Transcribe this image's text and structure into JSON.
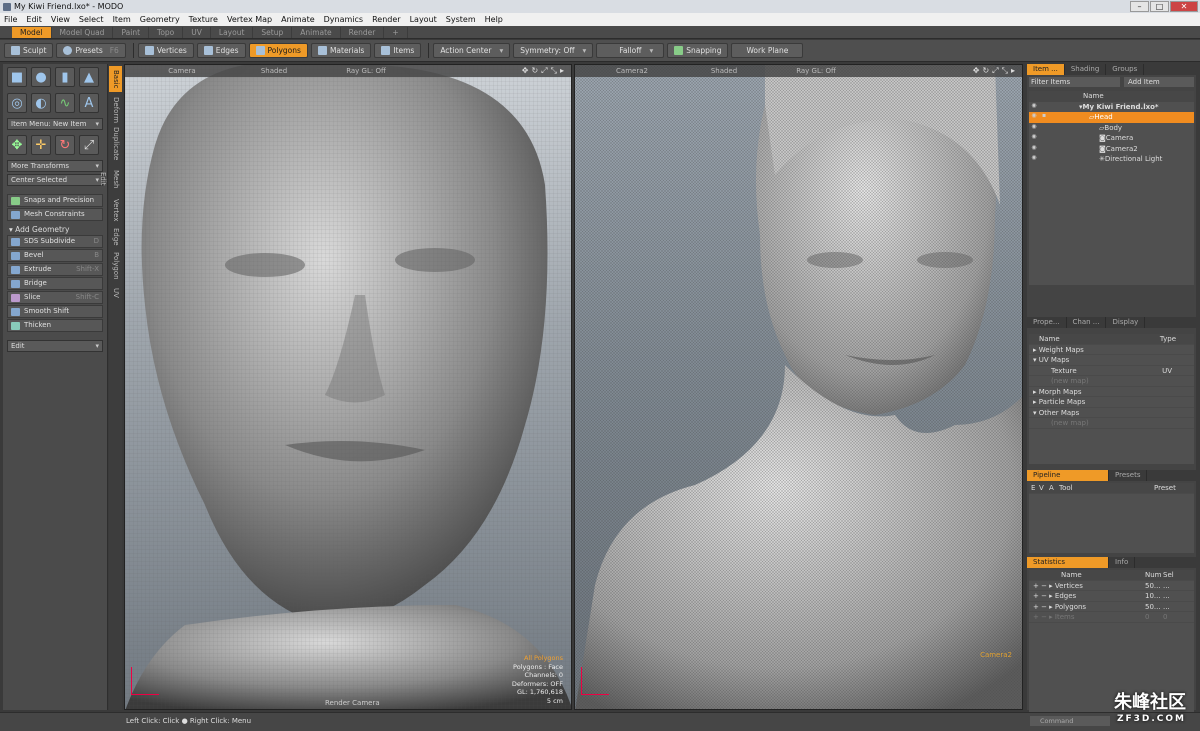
{
  "window": {
    "title": "My Kiwi Friend.lxo* - MODO",
    "min": "–",
    "max": "□",
    "close": "✕"
  },
  "menu": [
    "File",
    "Edit",
    "View",
    "Select",
    "Item",
    "Geometry",
    "Texture",
    "Vertex Map",
    "Animate",
    "Dynamics",
    "Render",
    "Layout",
    "System",
    "Help"
  ],
  "layout_tabs": [
    "Model",
    "Model Quad",
    "Paint",
    "Topo",
    "UV",
    "Layout",
    "Setup",
    "Animate",
    "Render",
    "+"
  ],
  "toolbar": {
    "sculpt": "Sculpt",
    "presets": "Presets",
    "presets_key": "F6",
    "vertices": "Vertices",
    "edges": "Edges",
    "polygons": "Polygons",
    "materials": "Materials",
    "items": "Items",
    "action_center": "Action Center",
    "symmetry": "Symmetry: Off",
    "falloff": "Falloff",
    "snapping": "Snapping",
    "work_plane": "Work Plane"
  },
  "left": {
    "item_menu": "Item Menu: New Item",
    "more_transforms": "More Transforms",
    "center_selected": "Center Selected",
    "snaps_precision": "Snaps and Precision",
    "mesh_constraints": "Mesh Constraints",
    "add_geometry": "Add Geometry",
    "tools": [
      {
        "label": "SDS Subdivide",
        "key": "D"
      },
      {
        "label": "Bevel",
        "key": "B"
      },
      {
        "label": "Extrude",
        "key": "Shift-X"
      },
      {
        "label": "Bridge",
        "key": ""
      },
      {
        "label": "Slice",
        "key": "Shift-C"
      },
      {
        "label": "Smooth Shift",
        "key": ""
      },
      {
        "label": "Thicken",
        "key": ""
      }
    ],
    "edit": "Edit"
  },
  "vtabs": [
    "Basic",
    "Deform",
    "Duplicate",
    "Mesh Edit",
    "Vertex",
    "Edge",
    "Polygon",
    "UV"
  ],
  "viewport1": {
    "camera": "Camera",
    "shading": "Shaded",
    "raygl": "Ray GL: Off",
    "stats": [
      "All Polygons",
      "Polygons : Face",
      "Channels: 0",
      "Deformers: OFF",
      "GL: 1,760,618",
      "5 cm"
    ],
    "render_camera": "Render Camera"
  },
  "viewport2": {
    "camera": "Camera2",
    "shading": "Shaded",
    "raygl": "Ray GL: Off",
    "label": "Camera2"
  },
  "items_panel": {
    "tabs": [
      "Item ...",
      "Shading",
      "Groups"
    ],
    "filter": "Filter Items",
    "add_item": "Add Item",
    "col_name": "Name",
    "tree": [
      {
        "name": "My Kiwi Friend.lxo*",
        "indent": 0
      },
      {
        "name": "Head",
        "indent": 1
      },
      {
        "name": "Body",
        "indent": 1
      },
      {
        "name": "Camera",
        "indent": 1
      },
      {
        "name": "Camera2",
        "indent": 1
      },
      {
        "name": "Directional Light",
        "indent": 1
      }
    ]
  },
  "maps_panel": {
    "tabs": [
      "Prope...",
      "Chan ...",
      "Display"
    ],
    "col_name": "Name",
    "col_type": "Type",
    "rows": [
      {
        "name": "Weight Maps",
        "type": ""
      },
      {
        "name": "UV Maps",
        "type": ""
      },
      {
        "name": "Texture",
        "type": "UV"
      },
      {
        "name": "(new map)",
        "type": ""
      },
      {
        "name": "Morph Maps",
        "type": ""
      },
      {
        "name": "Particle Maps",
        "type": ""
      },
      {
        "name": "Other Maps",
        "type": ""
      },
      {
        "name": "(new map)",
        "type": ""
      }
    ]
  },
  "pipeline_panel": {
    "tabs": [
      "Pipeline",
      "Presets"
    ],
    "cols": [
      "E",
      "V",
      "A",
      "Tool",
      "Preset"
    ]
  },
  "stats_panel": {
    "tabs": [
      "Statistics",
      "Info"
    ],
    "col_name": "Name",
    "col_num": "Num",
    "col_sel": "Sel",
    "rows": [
      {
        "name": "Vertices",
        "num": "50...",
        "sel": "..."
      },
      {
        "name": "Edges",
        "num": "10...",
        "sel": "..."
      },
      {
        "name": "Polygons",
        "num": "50...",
        "sel": "..."
      },
      {
        "name": "Items",
        "num": "0",
        "sel": "0"
      }
    ]
  },
  "statusbar": {
    "text": "Left Click: Click ● Right Click: Menu",
    "command": "Command"
  },
  "watermark": {
    "text": "朱峰社区",
    "sub": "ZF3D.COM"
  }
}
